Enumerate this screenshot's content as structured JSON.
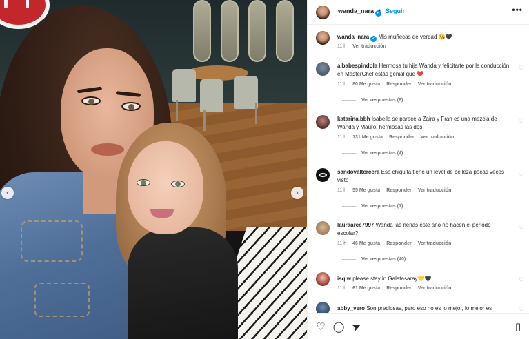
{
  "post": {
    "username": "wanda_nara",
    "follow_label": "Seguir",
    "separator": "•",
    "caption": "Mis muñecas de verdad 😘🖤",
    "caption_time": "11 h",
    "caption_translate": "Ver traducción"
  },
  "comments": [
    {
      "username": "albabespindola",
      "text": "Hermosa tu hija Wanda y felicitarte por la conducción en MasterChef estás genial que ❤️",
      "time": "11 h",
      "likes": "80 Me gusta",
      "reply": "Responder",
      "translate": "Ver traducción",
      "replies": "Ver respuestas (6)"
    },
    {
      "username": "katarina.bbh",
      "text": "Isabella se parece a Zaira y Fran es una mezcla de Wanda y Mauro, hermosas las dos",
      "time": "11 h",
      "likes": "131 Me gusta",
      "reply": "Responder",
      "translate": "Ver traducción",
      "replies": "Ver respuestas (4)"
    },
    {
      "username": "sandovaltercera",
      "text": "Esa chiquita tiene un level de belleza pocas veces visto",
      "time": "11 h",
      "likes": "55 Me gusta",
      "reply": "Responder",
      "translate": "Ver traducción",
      "replies": "Ver respuestas (1)"
    },
    {
      "username": "lauraarce7997",
      "text": "Wanda las nenas esté año no hacen el periodo escolar?",
      "time": "11 h",
      "likes": "46 Me gusta",
      "reply": "Responder",
      "translate": "Ver traducción",
      "replies": "Ver respuestas (40)"
    },
    {
      "username": "isq.w",
      "text": "please stay in Galatasaray💛🖤",
      "time": "11 h",
      "likes": "61 Me gusta",
      "reply": "Responder",
      "translate": "Ver traducción",
      "replies": ""
    },
    {
      "username": "abby_vero",
      "text": "Son preciosas, pero eso no es lo mejor, lo mejor es",
      "time": "",
      "likes": "",
      "reply": "",
      "translate": "",
      "replies": ""
    }
  ],
  "icons": {
    "heart": "heart-icon",
    "comment": "comment-icon",
    "share": "send-icon",
    "save": "bookmark-icon",
    "more": "more-options-icon",
    "prev": "chevron-left-icon",
    "next": "chevron-right-icon"
  },
  "glyphs": {
    "more": "•••",
    "prev": "‹",
    "next": "›",
    "heart": "♡",
    "comment": "◯",
    "share": "➤",
    "save": "▯",
    "verified": "✓"
  },
  "colors": {
    "accent": "#0095f6",
    "text": "#262626",
    "muted": "#737373"
  }
}
